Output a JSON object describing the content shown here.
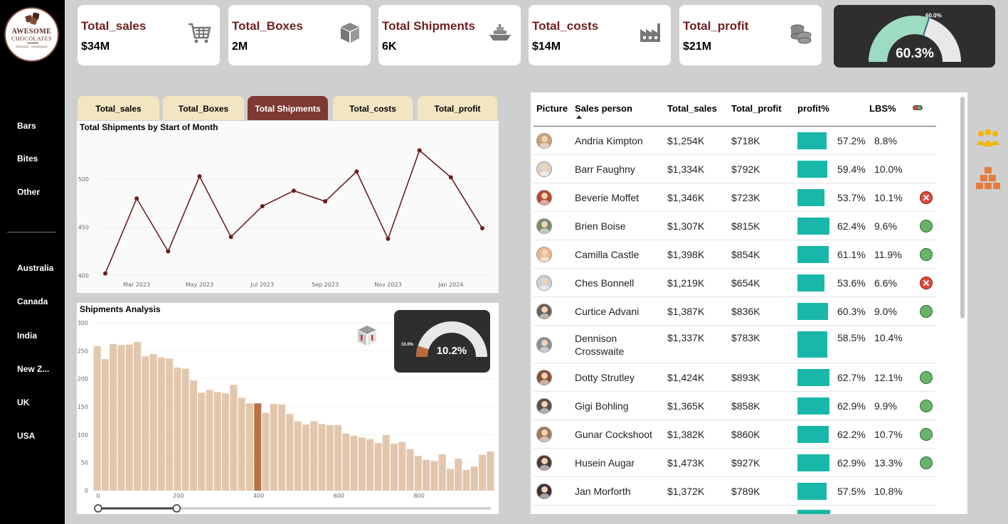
{
  "brand": {
    "line1": "AWESOME",
    "line2": "CHOCOLATES",
    "line3": "ORGANIC · HANDMADE"
  },
  "sidebar": {
    "categories": [
      "Bars",
      "Bites",
      "Other"
    ],
    "countries": [
      "Australia",
      "Canada",
      "India",
      "New Z...",
      "UK",
      "USA"
    ]
  },
  "kpis": [
    {
      "title": "Total_sales",
      "value": "$34M",
      "icon": "shopping-cart-icon"
    },
    {
      "title": "Total_Boxes",
      "value": "2M",
      "icon": "box-icon"
    },
    {
      "title": "Total Shipments",
      "value": "6K",
      "icon": "ship-icon"
    },
    {
      "title": "Total_costs",
      "value": "$14M",
      "icon": "factory-icon"
    },
    {
      "title": "Total_profit",
      "value": "$21M",
      "icon": "coins-icon"
    }
  ],
  "profit_gauge": {
    "value": 60.3,
    "value_label": "60.3%",
    "target": 60.0,
    "target_label": "60.0%",
    "fill_color": "#9ddbc2",
    "track_color": "#e8e8e8"
  },
  "tabs": [
    "Total_sales",
    "Total_Boxes",
    "Total Shipments",
    "Total_costs",
    "Total_profit"
  ],
  "active_tab": 2,
  "line_title": "Total Shipments by Start of Month",
  "hist_title": "Shipments Analysis",
  "lbs_gauge": {
    "value": 10.2,
    "value_label": "10.2%",
    "target_label": "10.0%",
    "fill_color": "#b86b3b",
    "track_color": "#e8e8e8"
  },
  "chart_data": [
    {
      "type": "line",
      "title": "Total Shipments by Start of Month",
      "x": [
        "Feb 2023",
        "Mar 2023",
        "Apr 2023",
        "May 2023",
        "Jun 2023",
        "Jul 2023",
        "Aug 2023",
        "Sep 2023",
        "Oct 2023",
        "Nov 2023",
        "Dec 2023",
        "Jan 2024",
        "Feb 2024"
      ],
      "x_tick_labels": [
        "Mar 2023",
        "May 2023",
        "Jul 2023",
        "Sep 2023",
        "Nov 2023",
        "Jan 2024"
      ],
      "values": [
        402,
        480,
        425,
        503,
        440,
        472,
        488,
        477,
        508,
        438,
        530,
        502,
        449
      ],
      "yticks": [
        400,
        450,
        500
      ],
      "ylim": [
        398,
        540
      ],
      "color": "#6b1f1f",
      "grid": true
    },
    {
      "type": "bar",
      "title": "Shipments Analysis",
      "bin_width": 20,
      "x_start": 0,
      "values": [
        258,
        235,
        262,
        260,
        261,
        266,
        240,
        244,
        238,
        236,
        220,
        218,
        197,
        175,
        180,
        176,
        174,
        189,
        166,
        156,
        156,
        139,
        155,
        154,
        137,
        124,
        118,
        124,
        119,
        117,
        117,
        102,
        98,
        95,
        92,
        85,
        99,
        84,
        87,
        74,
        62,
        55,
        53,
        65,
        39,
        57,
        37,
        43,
        64,
        70
      ],
      "highlight_index": 20,
      "highlight_value": 139,
      "bar_color": "#e3c7ad",
      "highlight_color": "#b87344",
      "xticks": [
        0,
        200,
        400,
        600,
        800
      ],
      "yticks": [
        0,
        50,
        100,
        150,
        200,
        250,
        300
      ],
      "ylim": [
        0,
        300
      ],
      "slider_range": [
        0,
        200
      ]
    }
  ],
  "table": {
    "headers": [
      "Picture",
      "Sales person",
      "Total_sales",
      "Total_profit",
      "profit%",
      "LBS%"
    ],
    "rows": [
      {
        "name": "Andria Kimpton",
        "sales": "$1,254K",
        "profit": "$718K",
        "pct": "57.2%",
        "pct_val": 57.2,
        "lbs": "8.8%",
        "status": "none",
        "avatar_color": "#c9a27a"
      },
      {
        "name": "Barr Faughny",
        "sales": "$1,334K",
        "profit": "$792K",
        "pct": "59.4%",
        "pct_val": 59.4,
        "lbs": "10.0%",
        "status": "none",
        "avatar_color": "#d9d2cc"
      },
      {
        "name": "Beverie Moffet",
        "sales": "$1,346K",
        "profit": "$723K",
        "pct": "53.7%",
        "pct_val": 53.7,
        "lbs": "10.1%",
        "status": "bad",
        "avatar_color": "#b54a2e"
      },
      {
        "name": "Brien Boise",
        "sales": "$1,307K",
        "profit": "$815K",
        "pct": "62.4%",
        "pct_val": 62.4,
        "lbs": "9.6%",
        "status": "ok",
        "avatar_color": "#7a8a6a"
      },
      {
        "name": "Camilla Castle",
        "sales": "$1,398K",
        "profit": "$854K",
        "pct": "61.1%",
        "pct_val": 61.1,
        "lbs": "11.9%",
        "status": "ok",
        "avatar_color": "#e7b88f"
      },
      {
        "name": "Ches Bonnell",
        "sales": "$1,219K",
        "profit": "$654K",
        "pct": "53.6%",
        "pct_val": 53.6,
        "lbs": "6.6%",
        "status": "bad",
        "avatar_color": "#cfcfd3"
      },
      {
        "name": "Curtice Advani",
        "sales": "$1,387K",
        "profit": "$836K",
        "pct": "60.3%",
        "pct_val": 60.3,
        "lbs": "9.0%",
        "status": "ok",
        "avatar_color": "#6a6058"
      },
      {
        "name": "Dennison Crosswaite",
        "sales": "$1,337K",
        "profit": "$783K",
        "pct": "58.5%",
        "pct_val": 58.5,
        "lbs": "10.4%",
        "status": "none",
        "avatar_color": "#8a8f92"
      },
      {
        "name": "Dotty Strutley",
        "sales": "$1,424K",
        "profit": "$893K",
        "pct": "62.7%",
        "pct_val": 62.7,
        "lbs": "12.1%",
        "status": "ok",
        "avatar_color": "#8a4e38"
      },
      {
        "name": "Gigi Bohling",
        "sales": "$1,365K",
        "profit": "$858K",
        "pct": "62.9%",
        "pct_val": 62.9,
        "lbs": "9.9%",
        "status": "ok",
        "avatar_color": "#5a4c46"
      },
      {
        "name": "Gunar Cockshoot",
        "sales": "$1,382K",
        "profit": "$860K",
        "pct": "62.2%",
        "pct_val": 62.2,
        "lbs": "10.7%",
        "status": "ok",
        "avatar_color": "#a17a5a"
      },
      {
        "name": "Husein Augar",
        "sales": "$1,473K",
        "profit": "$927K",
        "pct": "62.9%",
        "pct_val": 62.9,
        "lbs": "13.3%",
        "status": "ok",
        "avatar_color": "#4a3a36"
      },
      {
        "name": "Jan Morforth",
        "sales": "$1,372K",
        "profit": "$789K",
        "pct": "57.5%",
        "pct_val": 57.5,
        "lbs": "10.8%",
        "status": "none",
        "avatar_color": "#3e3030"
      }
    ]
  },
  "colors": {
    "accent": "#7d3a33",
    "title": "#6e1f1f",
    "bar": "#19b7a9",
    "tab_bg": "#f2e6c2",
    "ok": "#68b46c",
    "bad": "#e4473a"
  }
}
